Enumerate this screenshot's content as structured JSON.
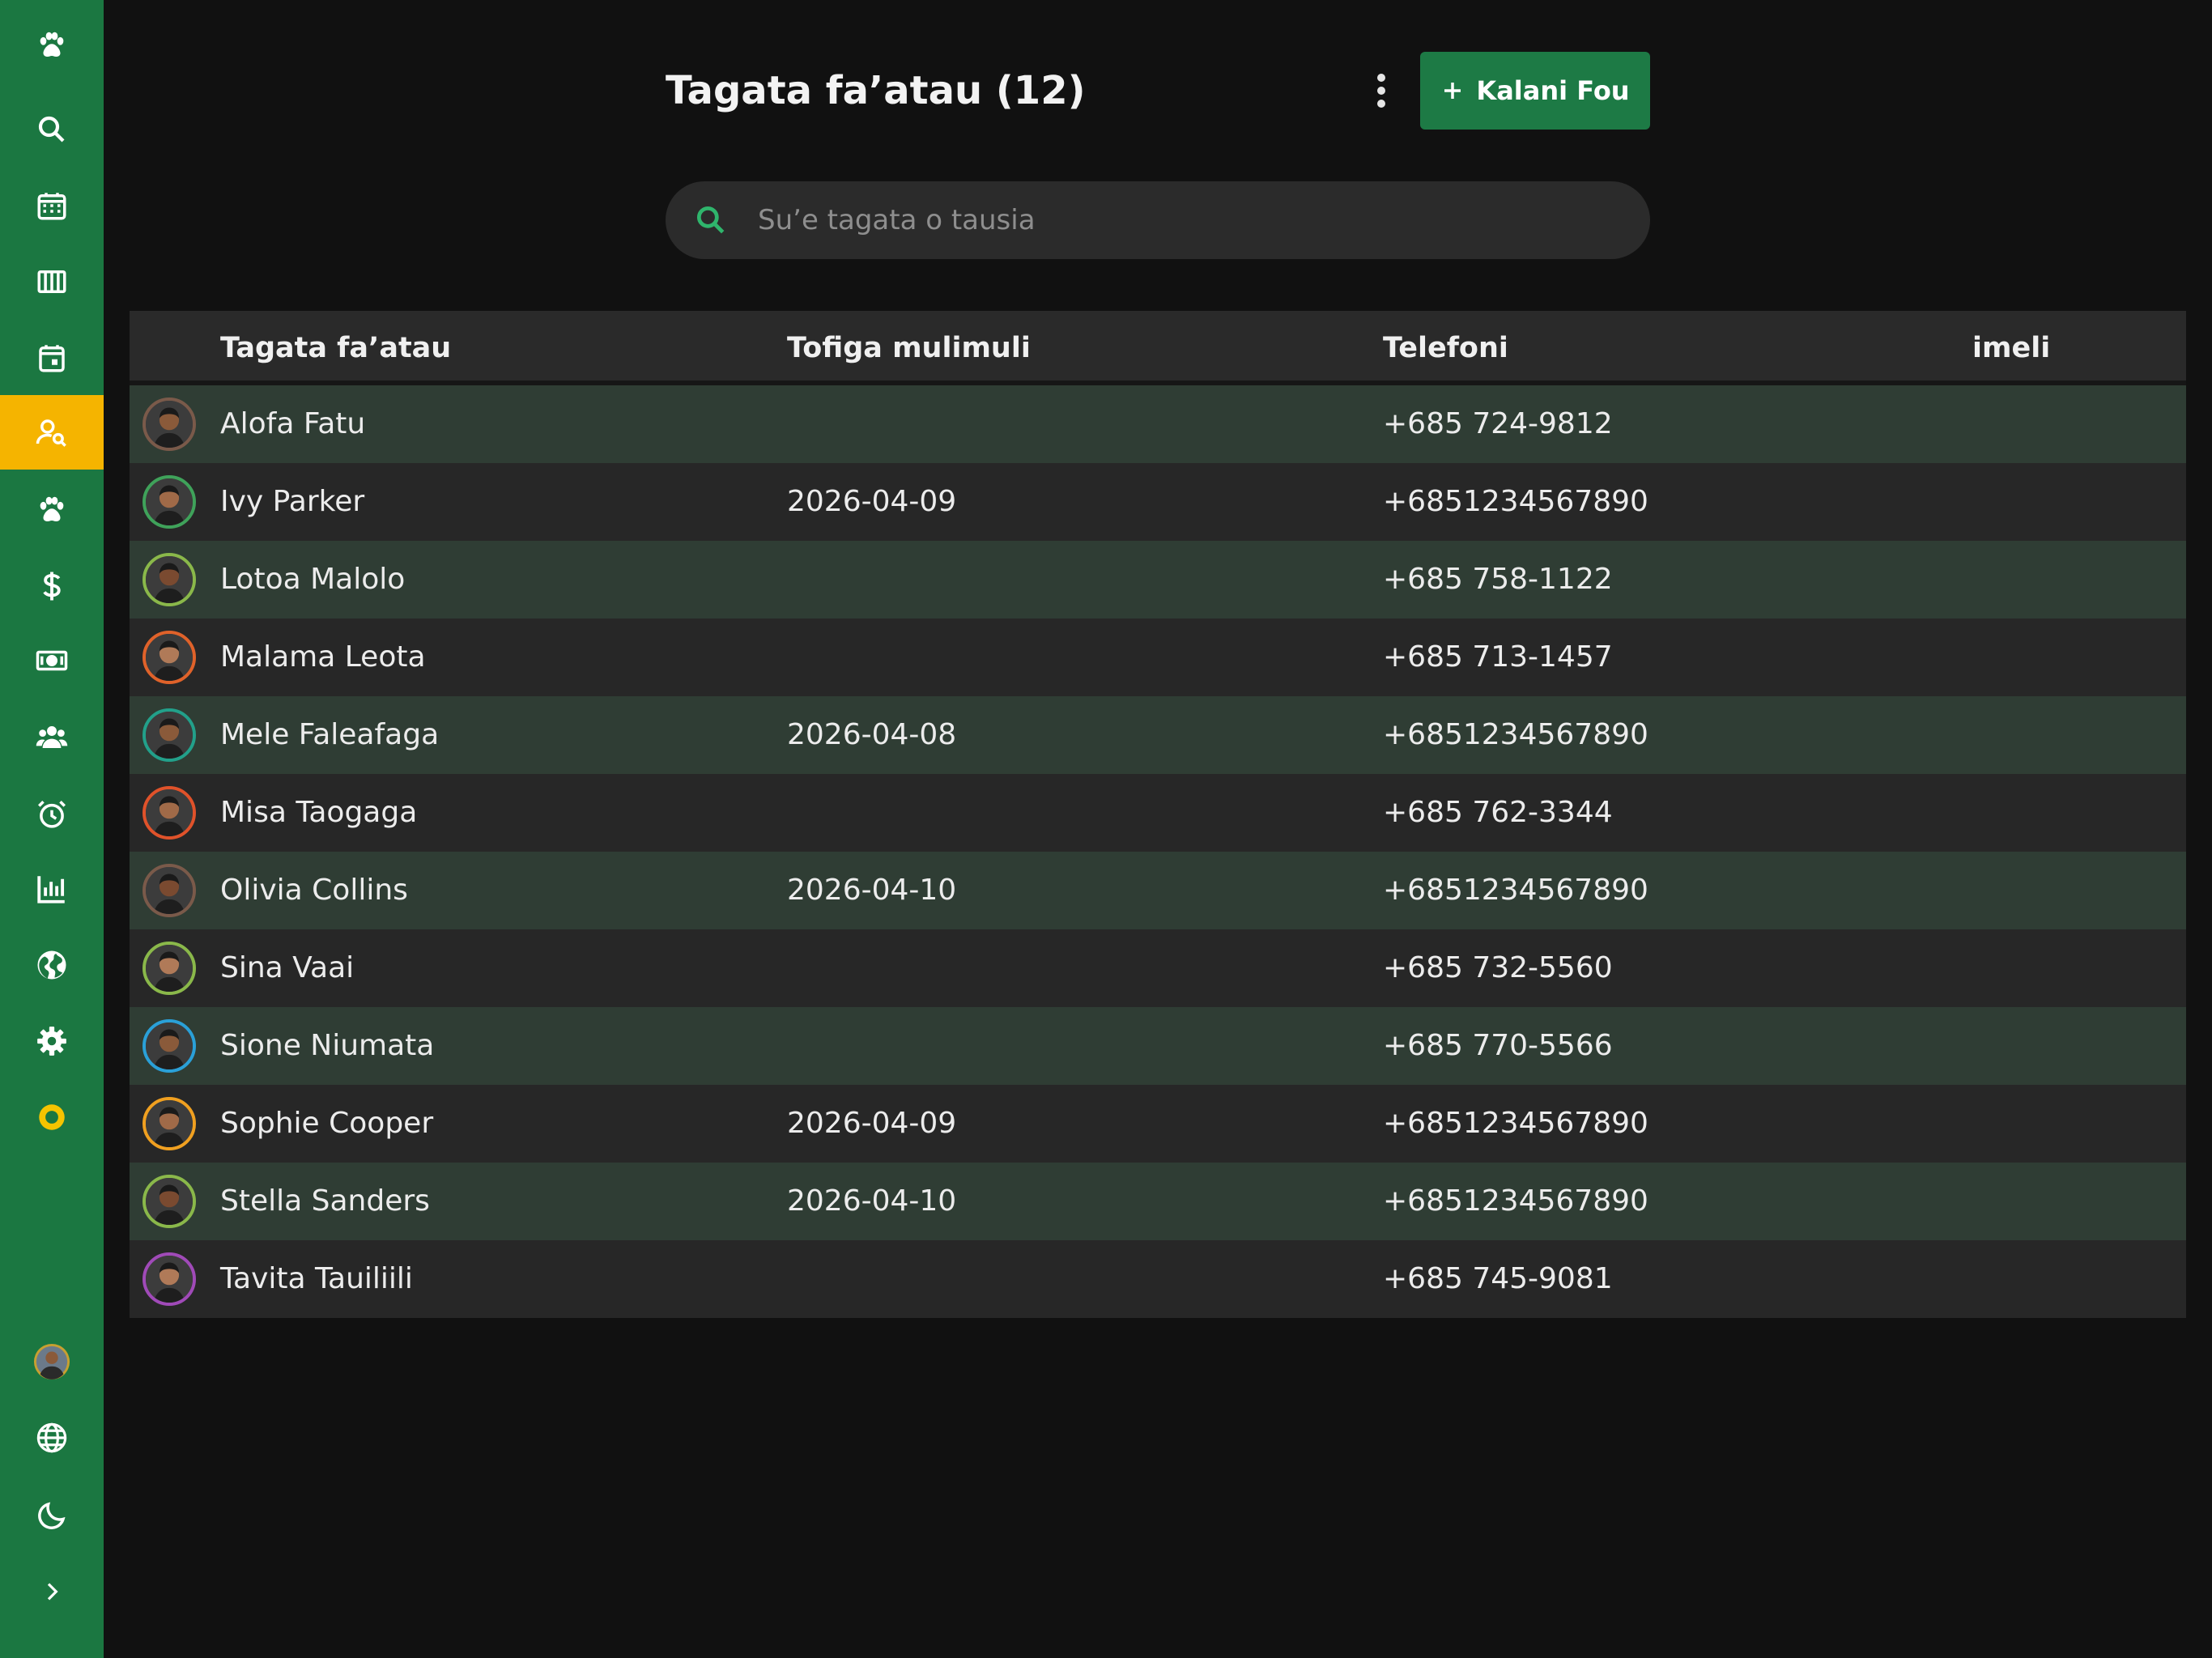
{
  "sidebar": {
    "items": [
      {
        "icon": "paw-icon",
        "name": "sidebar-item-logo"
      },
      {
        "icon": "search-icon",
        "name": "sidebar-item-search"
      },
      {
        "icon": "calendar-grid-icon",
        "name": "sidebar-item-calendar"
      },
      {
        "icon": "columns-icon",
        "name": "sidebar-item-board"
      },
      {
        "icon": "calendar-day-icon",
        "name": "sidebar-item-appointments"
      },
      {
        "icon": "user-search-icon",
        "name": "sidebar-item-clients",
        "active": true
      },
      {
        "icon": "paw-icon",
        "name": "sidebar-item-pets"
      },
      {
        "icon": "dollar-icon",
        "name": "sidebar-item-billing"
      },
      {
        "icon": "cash-icon",
        "name": "sidebar-item-payments"
      },
      {
        "icon": "users-icon",
        "name": "sidebar-item-staff"
      },
      {
        "icon": "alarm-icon",
        "name": "sidebar-item-reminders"
      },
      {
        "icon": "bar-chart-icon",
        "name": "sidebar-item-reports"
      },
      {
        "icon": "globe-filled-icon",
        "name": "sidebar-item-web"
      },
      {
        "icon": "gear-icon",
        "name": "sidebar-item-settings"
      },
      {
        "icon": "ring-icon",
        "name": "sidebar-item-status"
      }
    ],
    "bottom": [
      {
        "icon": "avatar-icon",
        "name": "sidebar-user-avatar"
      },
      {
        "icon": "globe-icon",
        "name": "sidebar-language"
      },
      {
        "icon": "moon-icon",
        "name": "sidebar-theme-toggle"
      },
      {
        "icon": "chevron-right-icon",
        "name": "sidebar-expand"
      }
    ],
    "active_color": "#f5b400",
    "background": "#1b7741"
  },
  "header": {
    "title": "Tagata fa’atau (12)",
    "add_label": "Kalani Fou"
  },
  "search": {
    "placeholder": "Su’e tagata o tausia"
  },
  "table": {
    "columns": [
      "Tagata fa’atau",
      "Tofiga mulimuli",
      "Telefoni",
      "imeli"
    ],
    "rows": [
      {
        "name": "Alofa Fatu",
        "last": "",
        "phone": "+685 724-9812",
        "email": "",
        "ring": "#7a5a4a"
      },
      {
        "name": "Ivy Parker",
        "last": "2026-04-09",
        "phone": "+6851234567890",
        "email": "",
        "ring": "#3fa25a"
      },
      {
        "name": "Lotoa Malolo",
        "last": "",
        "phone": "+685 758-1122",
        "email": "",
        "ring": "#8ab84a"
      },
      {
        "name": "Malama Leota",
        "last": "",
        "phone": "+685 713-1457",
        "email": "",
        "ring": "#e0622a"
      },
      {
        "name": "Mele Faleafaga",
        "last": "2026-04-08",
        "phone": "+6851234567890",
        "email": "",
        "ring": "#22a08a"
      },
      {
        "name": "Misa Taogaga",
        "last": "",
        "phone": "+685 762-3344",
        "email": "",
        "ring": "#e0522a"
      },
      {
        "name": "Olivia Collins",
        "last": "2026-04-10",
        "phone": "+6851234567890",
        "email": "",
        "ring": "#7a5a4a"
      },
      {
        "name": "Sina Vaai",
        "last": "",
        "phone": "+685 732-5560",
        "email": "",
        "ring": "#8ab84a"
      },
      {
        "name": "Sione Niumata",
        "last": "",
        "phone": "+685 770-5566",
        "email": "",
        "ring": "#2aa0d8"
      },
      {
        "name": "Sophie Cooper",
        "last": "2026-04-09",
        "phone": "+6851234567890",
        "email": "",
        "ring": "#f0a020"
      },
      {
        "name": "Stella Sanders",
        "last": "2026-04-10",
        "phone": "+6851234567890",
        "email": "",
        "ring": "#8ab84a"
      },
      {
        "name": "Tavita Tauiliili",
        "last": "",
        "phone": "+685 745-9081",
        "email": "",
        "ring": "#a04ab8"
      }
    ]
  }
}
